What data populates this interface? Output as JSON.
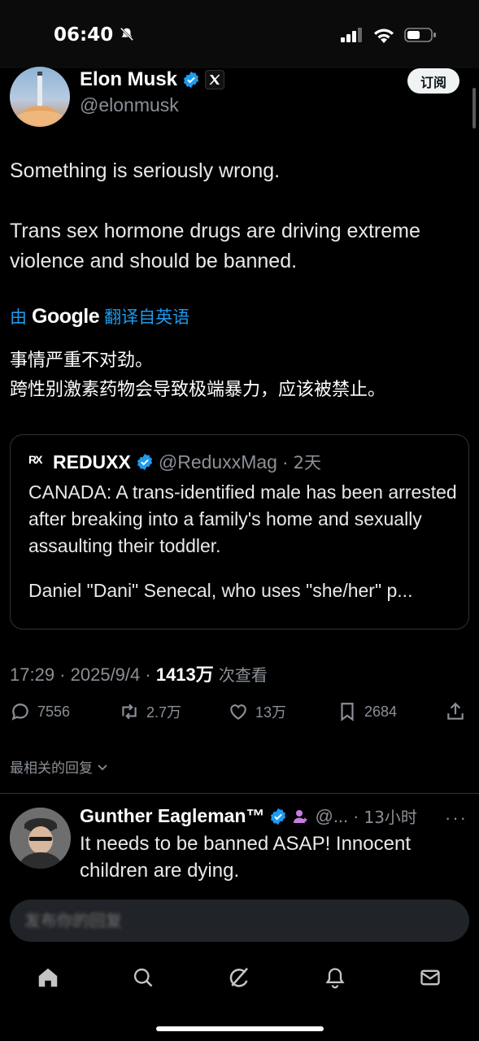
{
  "status_bar": {
    "time": "06:40"
  },
  "tweet": {
    "author_name": "Elon Musk",
    "author_handle": "@elonmusk",
    "subscribe_label": "订阅",
    "text_lines": [
      "Something is seriously wrong.",
      "Trans sex hormone drugs are driving extreme violence and should be banned."
    ],
    "translate_prefix": "由",
    "translate_brand": "Google",
    "translate_suffix": "翻译自英语",
    "translation_lines": [
      "事情严重不对劲。",
      "跨性别激素药物会导致极端暴力，应该被禁止。"
    ],
    "quote": {
      "author_name": "REDUXX",
      "author_handle": "@ReduxxMag",
      "time": "2天",
      "logo_text": "RX",
      "text": "CANADA: A trans-identified male has been arrested after breaking into a family's home and sexually assaulting their toddler.",
      "text2": "Daniel \"Dani\" Senecal, who uses \"she/her\" p..."
    },
    "time": "17:29",
    "date": "2025/9/4",
    "views": "1413万",
    "views_label": "次查看",
    "stats": {
      "replies": "7556",
      "reposts": "2.7万",
      "likes": "13万",
      "bookmarks": "2684"
    }
  },
  "replies_header": "最相关的回复",
  "reply": {
    "author_name": "Gunther Eagleman™",
    "author_handle": "@...",
    "time": "13小时",
    "text": "It needs to be banned ASAP!  Innocent children are dying."
  },
  "compose": {
    "placeholder": "发布你的回复"
  },
  "colors": {
    "background": "#000000",
    "accent": "#1d9bf0",
    "secondary_text": "#8b9096",
    "border": "#2f3336"
  },
  "icons": [
    "verified-badge-icon",
    "x-logo-icon",
    "reply-icon",
    "repost-icon",
    "like-icon",
    "bookmark-icon",
    "share-icon",
    "home-icon",
    "search-icon",
    "grok-icon",
    "notifications-icon",
    "messages-icon"
  ]
}
